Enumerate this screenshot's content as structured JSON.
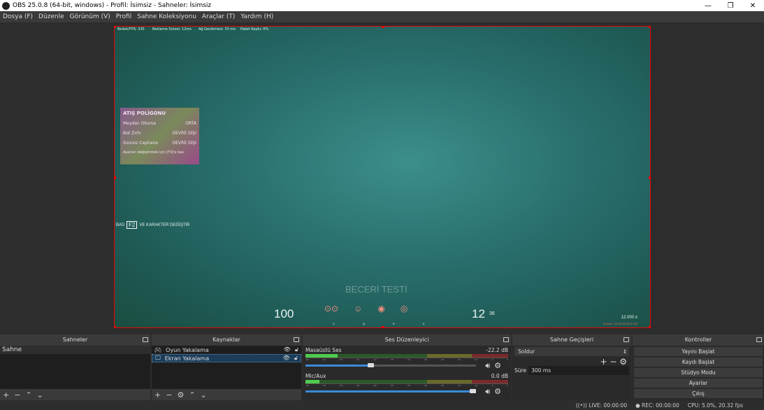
{
  "window": {
    "title": "OBS 25.0.8 (64-bit, windows) - Profil: İsimsiz - Sahneler: İsimsiz",
    "minimize": "—",
    "maximize": "❐",
    "close": "✕"
  },
  "menu": [
    "Dosya (F)",
    "Düzenle",
    "Görünüm (V)",
    "Profil",
    "Sahne Koleksiyonu",
    "Araçlar (T)",
    "Yardım (H)"
  ],
  "preview": {
    "top_overlay": [
      "Bellek/FPS: 335",
      "Bekleme Süresi: 12ms",
      "Ağ Gecikmesi: 33 ms",
      "Paket Kaybı: 0%"
    ],
    "menu_title": "ATIŞ POLİGONU",
    "menu_rows": [
      {
        "label": "Meydan Okuma",
        "value": "ORTA"
      },
      {
        "label": "Bot Zırhı",
        "value": "DEVRE DIŞI"
      },
      {
        "label": "Sınırsız Cephane",
        "value": "DEVRE DIŞI"
      }
    ],
    "menu_footer": "Ayarları değiştirmek için [F3]'e bas",
    "key_hint_prefix": "BAS",
    "key_hint_key": "F2",
    "key_hint_text": "VE KARAKTER DEĞİŞTİR",
    "center_text": "BECERİ TESTİ",
    "health": "100",
    "ammo": "12",
    "ammo_reserve": "36",
    "ability_keys": [
      "C",
      "Q",
      "E",
      "X"
    ],
    "credits": "12.000 ¤",
    "bottom_right_info": "Sunucu: 01.08.20.0471.230"
  },
  "docks": {
    "scenes": {
      "title": "Sahneler",
      "items": [
        "Sahne"
      ]
    },
    "sources": {
      "title": "Kaynaklar",
      "items": [
        {
          "name": "Oyun Yakalama",
          "icon": "gamepad-icon"
        },
        {
          "name": "Ekran Yakalama",
          "icon": "monitor-icon",
          "selected": true
        }
      ]
    },
    "mixer": {
      "title": "Ses Düzenleyici",
      "channels": [
        {
          "name": "Masaüstü Ses",
          "db": "-22.2 dB",
          "volume_pct": 40,
          "level_pct": 16
        },
        {
          "name": "Mic/Aux",
          "db": "0.0 dB",
          "volume_pct": 100,
          "level_pct": 7
        }
      ],
      "scale": [
        "-60",
        "-55",
        "-50",
        "-45",
        "-40",
        "-35",
        "-30",
        "-25",
        "-20",
        "-15",
        "-10",
        "-5",
        "0"
      ]
    },
    "transitions": {
      "title": "Sahne Geçişleri",
      "selected": "Soldur",
      "duration_label": "Süre",
      "duration": "300 ms"
    },
    "controls": {
      "title": "Kontroller",
      "buttons": [
        "Yayını Başlat",
        "Kaydı Başlat",
        "Stüdyo Modu",
        "Ayarlar",
        "Çıkış"
      ]
    }
  },
  "status": {
    "live": "LIVE: 00:00:00",
    "rec": "REC: 00:00:00",
    "cpu": "CPU: 5.0%, 20.32 fps"
  }
}
